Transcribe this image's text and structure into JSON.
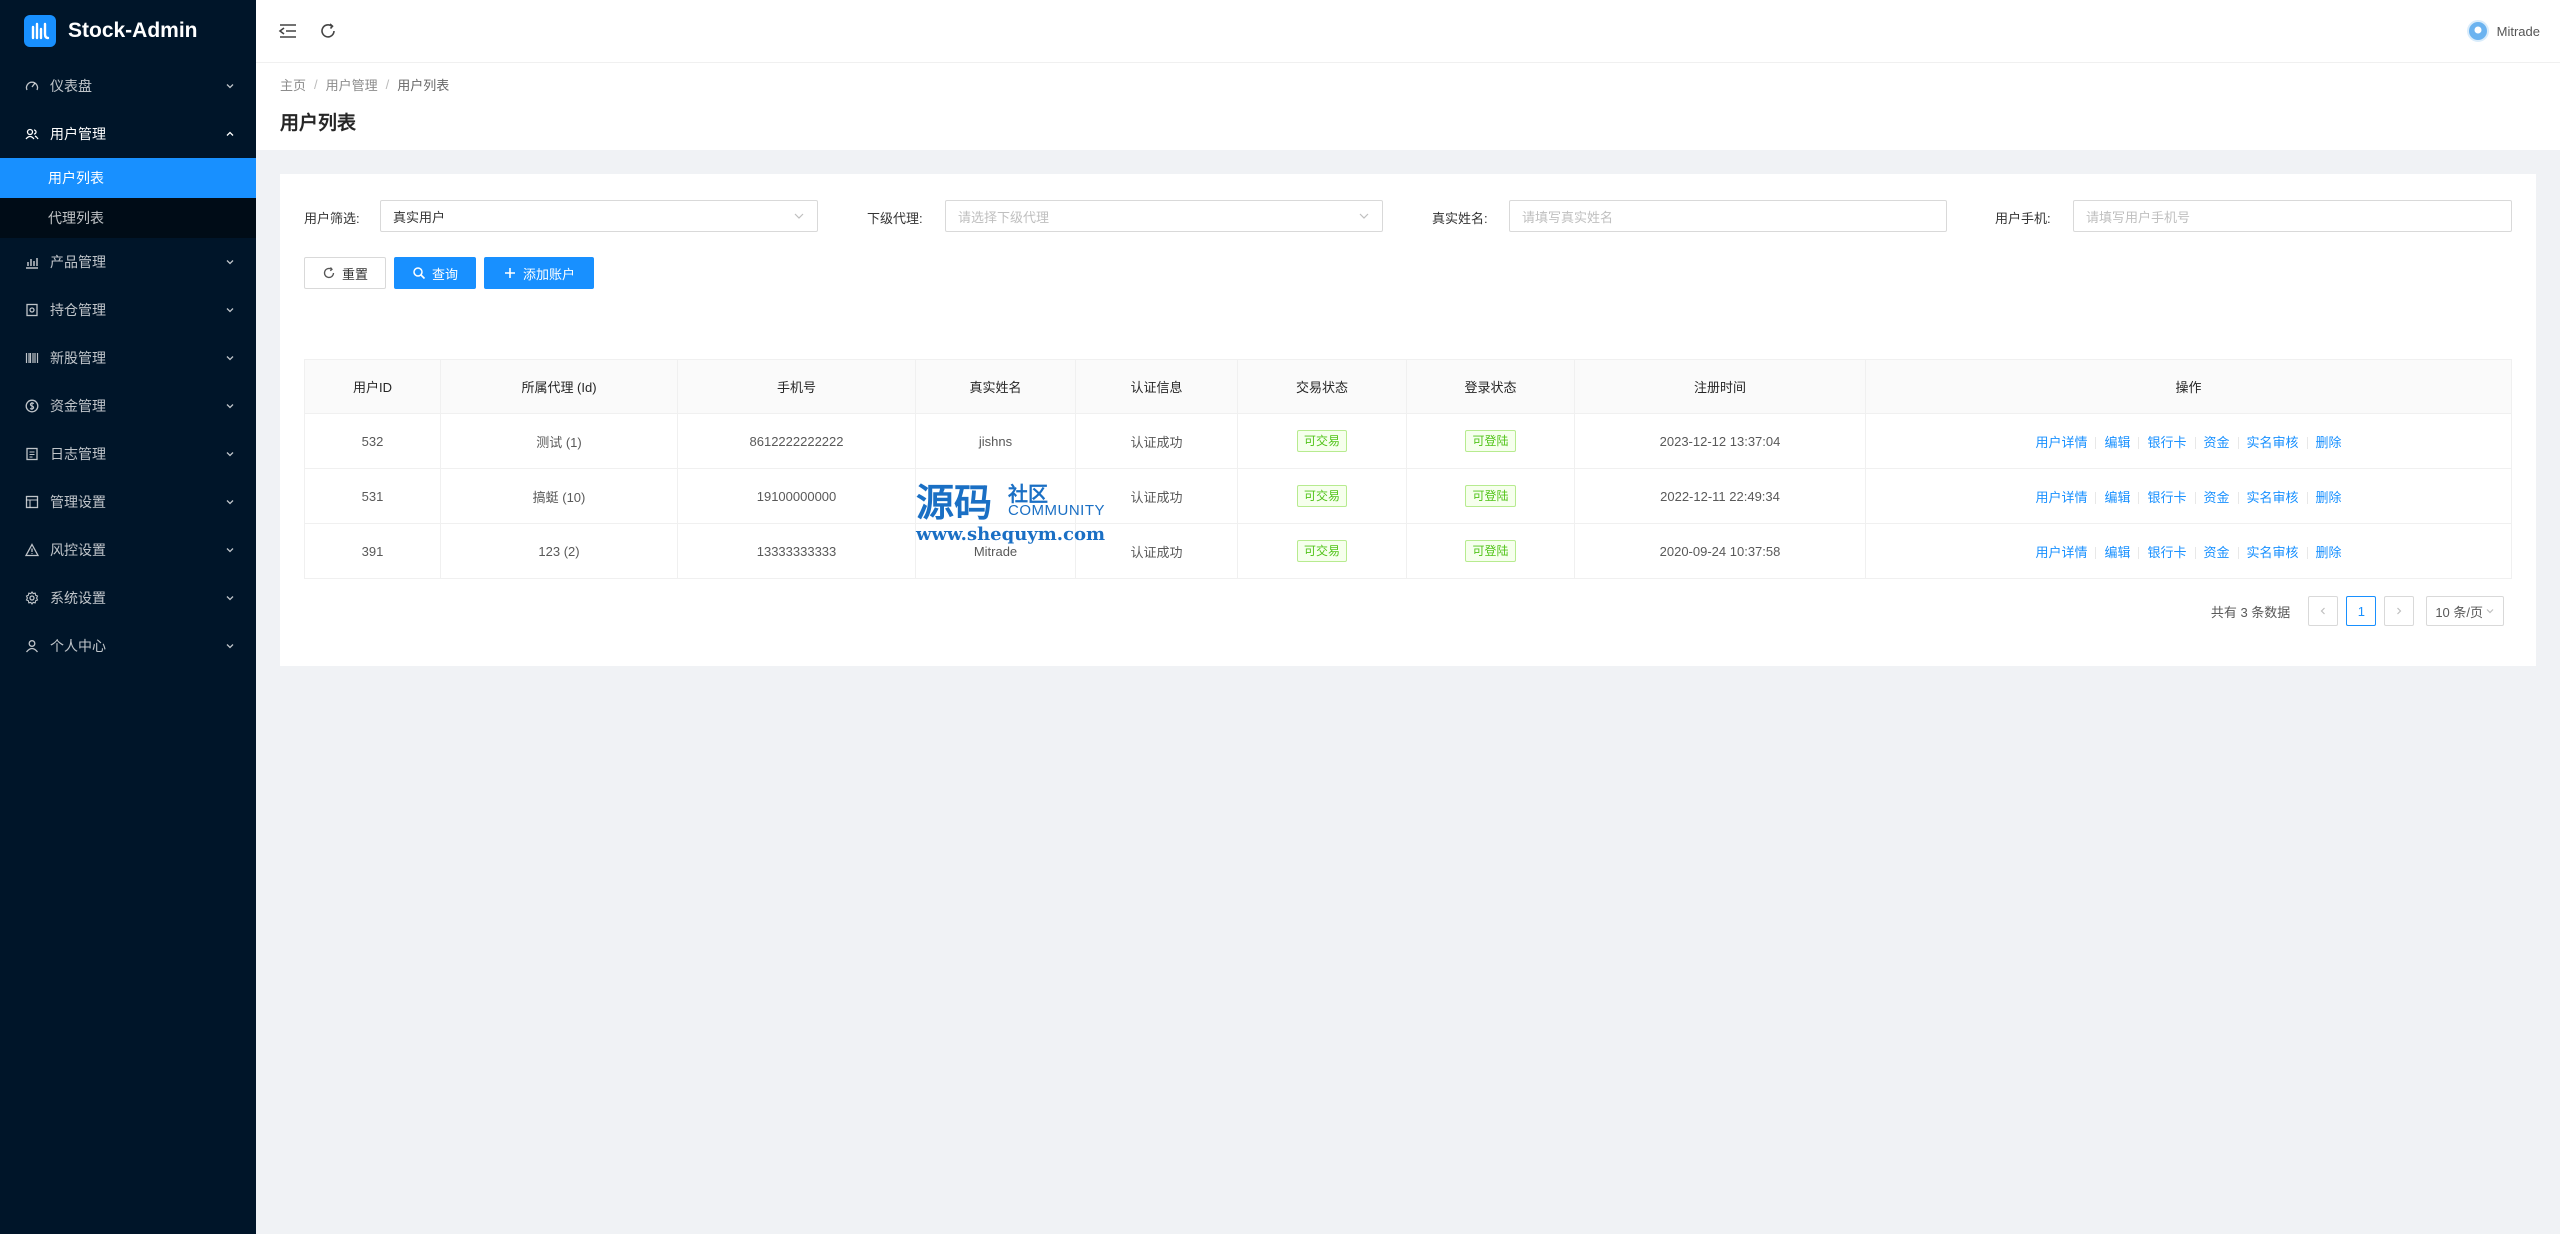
{
  "app": {
    "title": "Stock-Admin"
  },
  "colors": {
    "sidebar_bg": "#001529",
    "accent": "#1890ff",
    "success": "#52c41a"
  },
  "sidebar": {
    "items": [
      {
        "label": "仪表盘",
        "icon": "dashboard-icon"
      },
      {
        "label": "用户管理",
        "icon": "user-group-icon",
        "open": true,
        "children": [
          {
            "label": "用户列表",
            "active": true
          },
          {
            "label": "代理列表"
          }
        ]
      },
      {
        "label": "产品管理",
        "icon": "chart-icon"
      },
      {
        "label": "持仓管理",
        "icon": "position-icon"
      },
      {
        "label": "新股管理",
        "icon": "barcode-icon"
      },
      {
        "label": "资金管理",
        "icon": "money-icon"
      },
      {
        "label": "日志管理",
        "icon": "log-icon"
      },
      {
        "label": "管理设置",
        "icon": "admin-settings-icon"
      },
      {
        "label": "风控设置",
        "icon": "warning-icon"
      },
      {
        "label": "系统设置",
        "icon": "gear-icon"
      },
      {
        "label": "个人中心",
        "icon": "user-icon"
      }
    ]
  },
  "header": {
    "user_name": "Mitrade"
  },
  "breadcrumb": [
    "主页",
    "用户管理",
    "用户列表"
  ],
  "page_title": "用户列表",
  "filters": {
    "user_filter": {
      "label": "用户筛选:",
      "value": "真实用户"
    },
    "sub_agent": {
      "label": "下级代理:",
      "placeholder": "请选择下级代理"
    },
    "real_name": {
      "label": "真实姓名:",
      "placeholder": "请填写真实姓名"
    },
    "phone": {
      "label": "用户手机:",
      "placeholder": "请填写用户手机号"
    }
  },
  "buttons": {
    "reset": "重置",
    "query": "查询",
    "add": "添加账户"
  },
  "table": {
    "headers": [
      "用户ID",
      "所属代理 (Id)",
      "手机号",
      "真实姓名",
      "认证信息",
      "交易状态",
      "登录状态",
      "注册时间",
      "操作"
    ],
    "rows": [
      {
        "id": "532",
        "agent": "测试 (1)",
        "phone": "8612222222222",
        "name": "jishns",
        "auth": "认证成功",
        "trade": "可交易",
        "login": "可登陆",
        "time": "2023-12-12 13:37:04"
      },
      {
        "id": "531",
        "agent": "搞蜓 (10)",
        "phone": "19100000000",
        "name": "",
        "auth": "认证成功",
        "trade": "可交易",
        "login": "可登陆",
        "time": "2022-12-11 22:49:34"
      },
      {
        "id": "391",
        "agent": "123 (2)",
        "phone": "13333333333",
        "name": "Mitrade",
        "auth": "认证成功",
        "trade": "可交易",
        "login": "可登陆",
        "time": "2020-09-24 10:37:58"
      }
    ],
    "actions": [
      "用户详情",
      "编辑",
      "银行卡",
      "资金",
      "实名审核",
      "删除"
    ]
  },
  "pagination": {
    "total_text": "共有 3 条数据",
    "current_page": "1",
    "page_size": "10 条/页"
  },
  "watermark": {
    "big": "源码",
    "small": "社区",
    "en": "COMMUNITY",
    "url": "www.shequym.com"
  }
}
